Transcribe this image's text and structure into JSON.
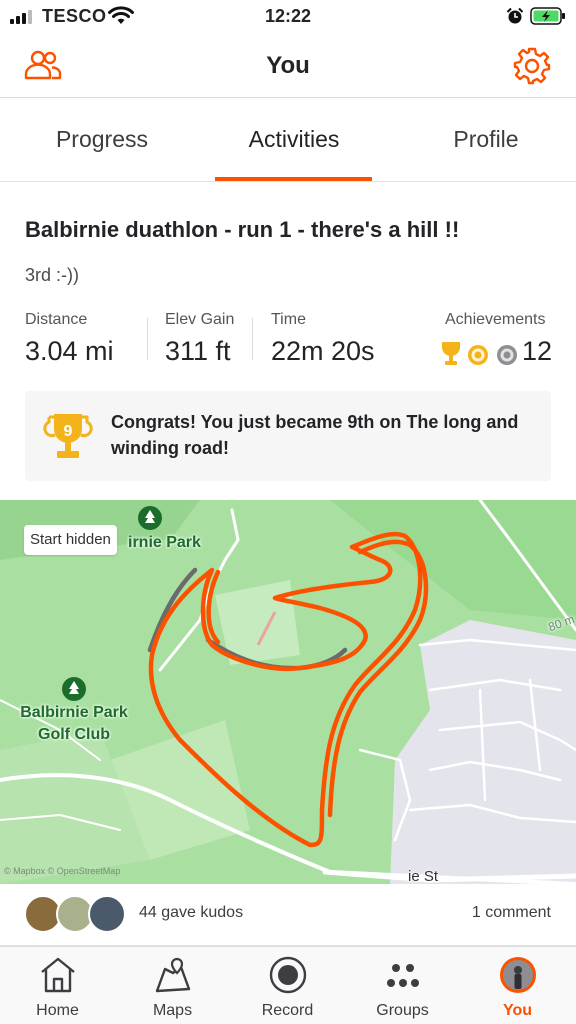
{
  "status_bar": {
    "carrier": "TESCO",
    "time": "12:22"
  },
  "header": {
    "title": "You",
    "friends_icon": "friends-icon",
    "settings_icon": "gear-icon"
  },
  "tabs": [
    {
      "label": "Progress",
      "active": false
    },
    {
      "label": "Activities",
      "active": true
    },
    {
      "label": "Profile",
      "active": false
    }
  ],
  "activity": {
    "title": "Balbirnie duathlon - run 1 - there's a hill !!",
    "description": "3rd :-))",
    "stats": {
      "distance_label": "Distance",
      "distance_value": "3.04 mi",
      "elev_label": "Elev Gain",
      "elev_value": "311 ft",
      "time_label": "Time",
      "time_value": "22m 20s",
      "achievements_label": "Achievements",
      "achievements_value": "12"
    },
    "congrats": {
      "trophy_rank": "9",
      "text": "Congrats! You just became 9th on The long and winding road!"
    }
  },
  "map": {
    "start_hidden_label": "Start hidden",
    "park_label": "Balbirnie Park",
    "park_label_visible": "irnie Park",
    "golf_label_line1": "Balbirnie Park",
    "golf_label_line2": "Golf Club",
    "contour_label": "80 m",
    "street_label": "ie St",
    "attribution": "© Mapbox © OpenStreetMap",
    "route_color": "#fc5200",
    "segment_color": "#6b6b6b"
  },
  "kudos": {
    "kudos_text": "44 gave kudos",
    "comments_text": "1 comment"
  },
  "bottom_nav": [
    {
      "label": "Home",
      "icon": "home-icon",
      "active": false
    },
    {
      "label": "Maps",
      "icon": "maps-icon",
      "active": false
    },
    {
      "label": "Record",
      "icon": "record-icon",
      "active": false
    },
    {
      "label": "Groups",
      "icon": "groups-icon",
      "active": false
    },
    {
      "label": "You",
      "icon": "profile-avatar-icon",
      "active": true
    }
  ],
  "colors": {
    "accent": "#fc5200",
    "trophy_gold": "#f5b31b",
    "map_green": "#a9dfa1"
  }
}
